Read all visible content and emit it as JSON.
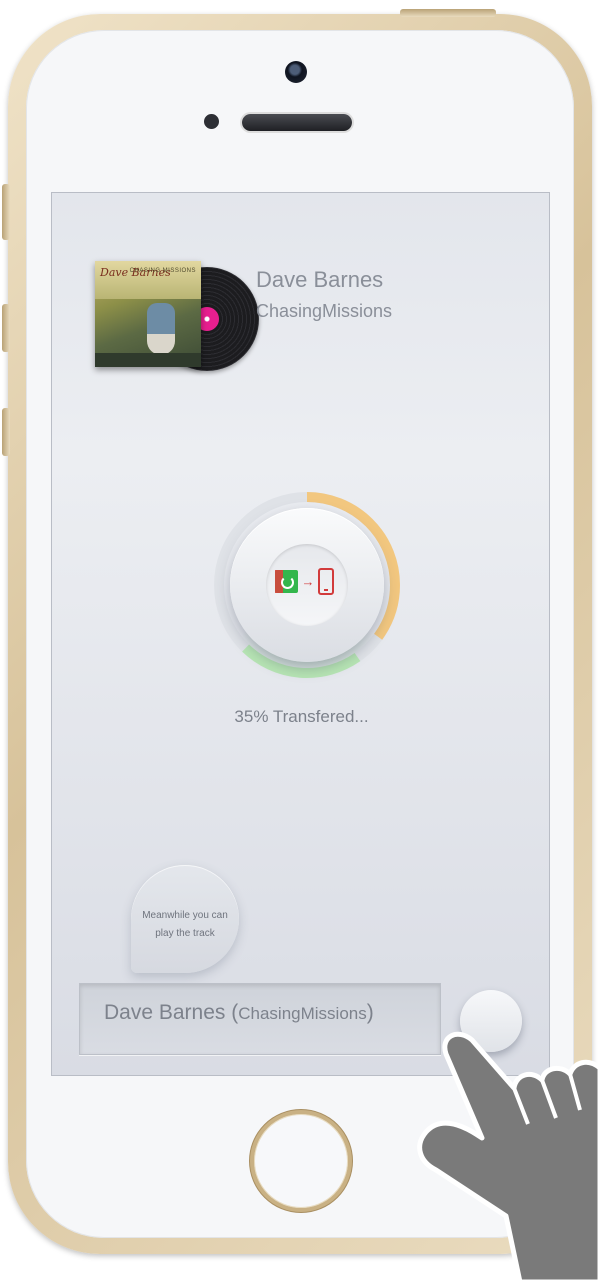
{
  "track": {
    "artist": "Dave Barnes",
    "album": "ChasingMissions",
    "cover_artist": "Dave Barnes",
    "cover_album": "CHASING MISSIONS"
  },
  "transfer": {
    "progress_fraction": 0.35,
    "status_text": "35% Transfered...",
    "source_icon": "pc-icon",
    "arrow_icon": "arrow-right-icon",
    "target_icon": "phone-icon",
    "colors": {
      "progress": "#f2c77f",
      "remaining": "#b7e5b4",
      "track": "#dfe2e7"
    }
  },
  "hint": {
    "line1": "Meanwhile you can",
    "line2": "play the track"
  },
  "now_playing": {
    "artist": "Dave Barnes",
    "open_paren": "(",
    "album": "ChasingMissions",
    "close_paren": ")"
  },
  "icons": [
    "camera-icon",
    "speaker-grille-icon",
    "home-button-icon",
    "vinyl-record-icon",
    "play-icon",
    "hand-pointer-icon"
  ]
}
